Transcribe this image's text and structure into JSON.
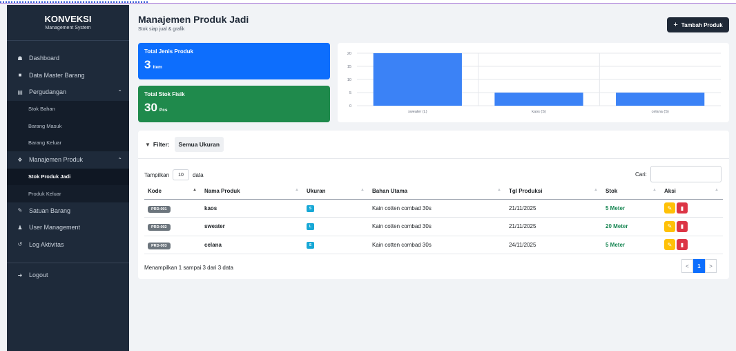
{
  "brand": {
    "name": "KONVEKSI",
    "tagline": "Management System"
  },
  "sidebar": {
    "items": [
      {
        "label": "Dashboard",
        "icon": "home-icon"
      },
      {
        "label": "Data Master Barang",
        "icon": "box-icon"
      },
      {
        "label": "Pergudangan",
        "icon": "warehouse-icon",
        "submenu": [
          "Stok Bahan",
          "Barang Masuk",
          "Barang Keluar"
        ]
      },
      {
        "label": "Manajemen Produk",
        "icon": "shirt-icon",
        "submenu": [
          "Stok Produk Jadi",
          "Produk Keluar"
        ],
        "active_sub": "Stok Produk Jadi"
      },
      {
        "label": "Satuan Barang",
        "icon": "ruler-icon"
      },
      {
        "label": "User Management",
        "icon": "users-icon"
      },
      {
        "label": "Log Aktivitas",
        "icon": "history-icon"
      }
    ],
    "logout": "Logout"
  },
  "header": {
    "title": "Manajemen Produk Jadi",
    "subtitle": "Stok siap jual & grafik",
    "add_button": "Tambah Produk"
  },
  "cards": [
    {
      "label": "Total Jenis Produk",
      "value": "3",
      "unit": "Item",
      "color": "#0d6efd"
    },
    {
      "label": "Total Stok Fisik",
      "value": "30",
      "unit": "Pcs",
      "color": "#1f8a4c"
    }
  ],
  "chart_data": {
    "type": "bar",
    "categories": [
      "sweater (L)",
      "kaos (S)",
      "celana (S)"
    ],
    "values": [
      20,
      5,
      5
    ],
    "ylim": [
      0,
      20
    ],
    "yticks": [
      0,
      5,
      10,
      15,
      20
    ],
    "bar_color": "#3b82f6",
    "grid": true
  },
  "filter": {
    "label": "Filter:",
    "value": "Semua Ukuran"
  },
  "table_controls": {
    "show_prefix": "Tampilkan",
    "show_value": "10",
    "show_suffix": "data",
    "search_label": "Cari:"
  },
  "table": {
    "columns": [
      "Kode",
      "Nama Produk",
      "Ukuran",
      "Bahan Utama",
      "Tgl Produksi",
      "Stok",
      "Aksi"
    ],
    "rows": [
      {
        "kode": "PRD-001",
        "nama": "kaos",
        "ukuran": "S",
        "bahan": "Kain cotten combad 30s",
        "tgl": "21/11/2025",
        "stok": "5 Meter"
      },
      {
        "kode": "PRD-002",
        "nama": "sweater",
        "ukuran": "L",
        "bahan": "Kain cotten combad 30s",
        "tgl": "21/11/2025",
        "stok": "20 Meter"
      },
      {
        "kode": "PRD-003",
        "nama": "celana",
        "ukuran": "S",
        "bahan": "Kain cotten combad 30s",
        "tgl": "24/11/2025",
        "stok": "5 Meter"
      }
    ]
  },
  "footer": {
    "info": "Menampilkan 1 sampai 3 dari 3 data",
    "prev": "<",
    "page": "1",
    "next": ">"
  }
}
